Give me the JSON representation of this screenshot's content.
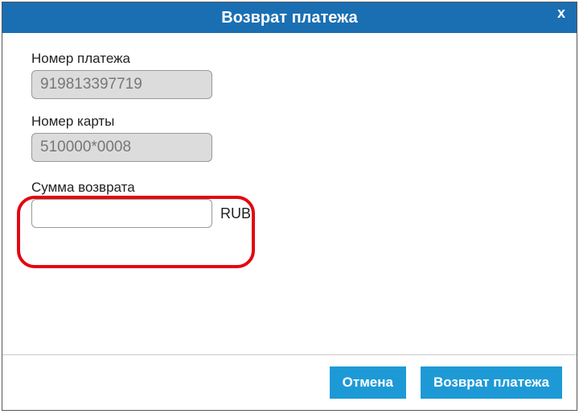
{
  "dialog": {
    "title": "Возврат платежа",
    "close": "x"
  },
  "fields": {
    "payment_number": {
      "label": "Номер платежа",
      "value": "919813397719"
    },
    "card_number": {
      "label": "Номер карты",
      "value": "510000*0008"
    },
    "refund_amount": {
      "label": "Сумма возврата",
      "value": "",
      "currency": "RUB"
    }
  },
  "footer": {
    "cancel": "Отмена",
    "submit": "Возврат платежа"
  }
}
